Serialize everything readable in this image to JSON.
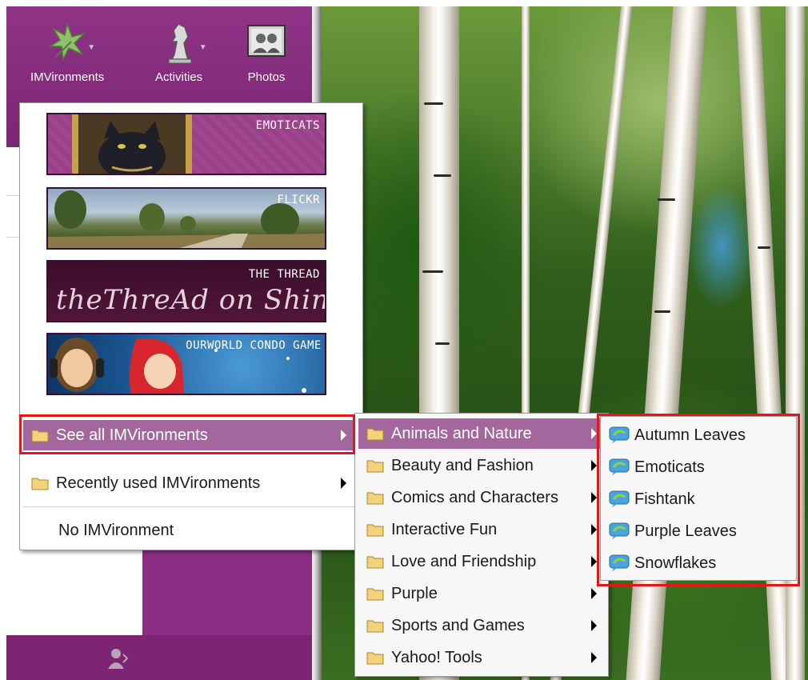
{
  "toolbar": {
    "buttons": [
      {
        "label": "IMVironments",
        "icon": "imvironments-icon"
      },
      {
        "label": "Activities",
        "icon": "chess-knight-icon"
      },
      {
        "label": "Photos",
        "icon": "photos-icon"
      }
    ]
  },
  "featured": [
    {
      "label": "EMOTICATS"
    },
    {
      "label": "FLICKR"
    },
    {
      "label": "THE THREAD",
      "logo_text": "theThreAd on Shine"
    },
    {
      "label": "OURWORLD CONDO GAME"
    }
  ],
  "menu": {
    "items": [
      {
        "label": "See all IMVironments",
        "has_submenu": true,
        "highlighted": true
      },
      {
        "label": "Recently used IMVironments",
        "has_submenu": true
      },
      {
        "label": "No IMVironment"
      }
    ]
  },
  "categories": [
    {
      "label": "Animals and Nature",
      "highlighted": true
    },
    {
      "label": "Beauty and Fashion"
    },
    {
      "label": "Comics and Characters"
    },
    {
      "label": "Interactive Fun"
    },
    {
      "label": "Love and Friendship"
    },
    {
      "label": "Purple"
    },
    {
      "label": "Sports and Games"
    },
    {
      "label": "Yahoo! Tools"
    }
  ],
  "themes": [
    {
      "label": "Autumn Leaves"
    },
    {
      "label": "Emoticats"
    },
    {
      "label": "Fishtank"
    },
    {
      "label": "Purple Leaves"
    },
    {
      "label": "Snowflakes"
    }
  ],
  "colors": {
    "app_purple": "#8c2e83",
    "menu_highlight": "#a4679d",
    "annotation_red": "#e01818"
  }
}
